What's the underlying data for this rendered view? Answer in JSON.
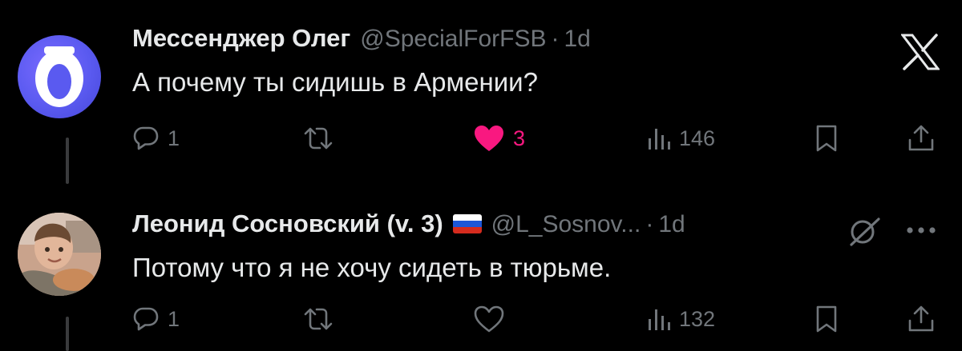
{
  "tweets": [
    {
      "name": "Мессенджер Олег",
      "handle": "@SpecialForFSB",
      "separator": "·",
      "time": "1d",
      "text": "А почему ты сидишь в Армении?",
      "replies": "1",
      "likes": "3",
      "views": "146",
      "liked": true,
      "avatar_letter": "O"
    },
    {
      "name": "Леонид Сосновский (v. 3)",
      "handle": "@L_Sosnov...",
      "separator": "·",
      "time": "1d",
      "text": "Потому что я не хочу сидеть в тюрьме.",
      "replies": "1",
      "likes": "",
      "views": "132",
      "liked": false
    }
  ],
  "colors": {
    "background": "#000000",
    "text": "#e7e9ea",
    "secondary": "#71767b",
    "like": "#f91880"
  }
}
